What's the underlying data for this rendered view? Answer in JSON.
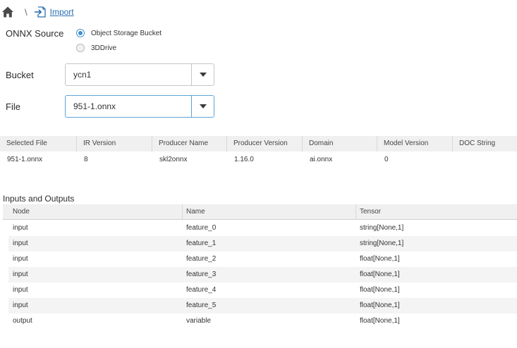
{
  "breadcrumb": {
    "separator": "\\",
    "link": "Import"
  },
  "source": {
    "label": "ONNX Source",
    "options": [
      {
        "label": "Object Storage Bucket",
        "checked": true
      },
      {
        "label": "3DDrive",
        "checked": false
      }
    ]
  },
  "bucket": {
    "label": "Bucket",
    "value": "ycn1"
  },
  "file": {
    "label": "File",
    "value": "951-1.onnx"
  },
  "file_info": {
    "headers": [
      "Selected File",
      "IR Version",
      "Producer Name",
      "Producer Version",
      "Domain",
      "Model Version",
      "DOC String"
    ],
    "row": [
      "951-1.onnx",
      "8",
      "skl2onnx",
      "1.16.0",
      "ai.onnx",
      "0",
      ""
    ]
  },
  "io": {
    "title": "Inputs and Outputs",
    "headers": [
      "Node",
      "Name",
      "Tensor"
    ],
    "rows": [
      [
        "input",
        "feature_0",
        "string[None,1]"
      ],
      [
        "input",
        "feature_1",
        "string[None,1]"
      ],
      [
        "input",
        "feature_2",
        "float[None,1]"
      ],
      [
        "input",
        "feature_3",
        "float[None,1]"
      ],
      [
        "input",
        "feature_4",
        "float[None,1]"
      ],
      [
        "input",
        "feature_5",
        "float[None,1]"
      ],
      [
        "output",
        "variable",
        "float[None,1]"
      ]
    ]
  },
  "colors": {
    "link": "#2a6fb0",
    "accent": "#3f8fd0",
    "header_bg": "#f0f0f0",
    "stripe_bg": "#f4f4f4"
  },
  "icons": [
    "home-icon",
    "import-icon",
    "chevron-down-icon"
  ]
}
